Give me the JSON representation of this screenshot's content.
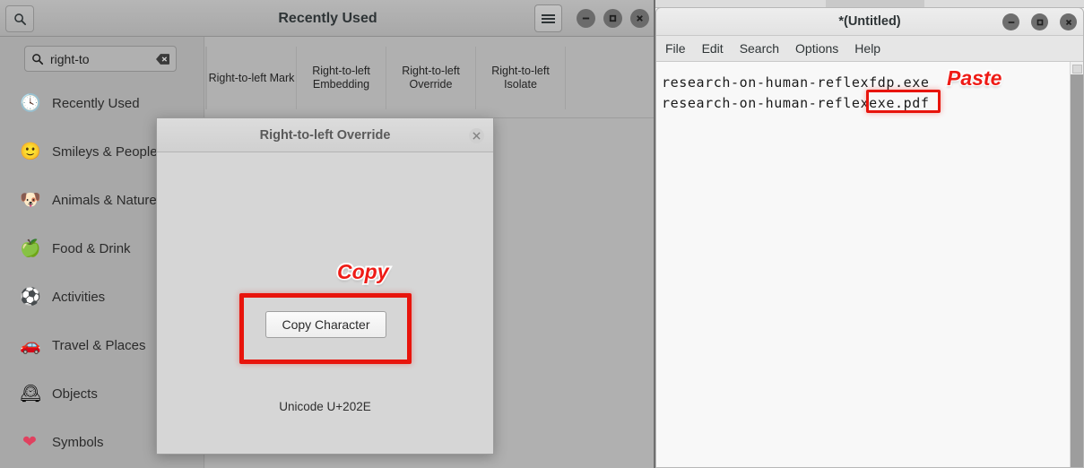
{
  "char_picker": {
    "title": "Recently Used",
    "search": {
      "value": "right-to",
      "icon": "search-icon",
      "clear_icon": "clear-icon"
    },
    "search_toggle_icon": "search-icon",
    "menu_icon": "hamburger-menu-icon",
    "window_buttons": {
      "minimize": "minimize-icon",
      "maximize": "maximize-icon",
      "close": "close-icon"
    },
    "sidebar": [
      {
        "label": "Recently Used",
        "emoji": "🕓",
        "icon": "clock-icon"
      },
      {
        "label": "Smileys & People",
        "emoji": "🙂",
        "icon": "smiley-icon"
      },
      {
        "label": "Animals & Nature",
        "emoji": "🐶",
        "icon": "dog-icon"
      },
      {
        "label": "Food & Drink",
        "emoji": "🍏",
        "icon": "apple-icon"
      },
      {
        "label": "Activities",
        "emoji": "⚽",
        "icon": "soccer-ball-icon"
      },
      {
        "label": "Travel & Places",
        "emoji": "🚗",
        "icon": "car-icon"
      },
      {
        "label": "Objects",
        "emoji": "🕰",
        "icon": "clock-object-icon"
      },
      {
        "label": "Symbols",
        "emoji": "❤",
        "icon": "heart-icon"
      }
    ],
    "characters": [
      {
        "label": "Right-to-left Mark"
      },
      {
        "label": "Right-to-left Embedding"
      },
      {
        "label": "Right-to-left Override"
      },
      {
        "label": "Right-to-left Isolate"
      }
    ]
  },
  "dialog": {
    "title": "Right-to-left Override",
    "close_icon": "close-icon",
    "copy_button": "Copy Character",
    "unicode": "Unicode U+202E"
  },
  "editor": {
    "title": "*(Untitled)",
    "menus": [
      "File",
      "Edit",
      "Search",
      "Options",
      "Help"
    ],
    "window_buttons": {
      "minimize": "minimize-icon",
      "maximize": "maximize-icon",
      "close": "close-icon"
    },
    "content": "research-on-human-reflexfdp.exe\nresearch-on-human-reflexexe.pdf",
    "scroll_arrow_icon": "scroll-up-arrow-icon"
  },
  "annotations": {
    "copy": "Copy",
    "paste": "Paste",
    "color": "#ee1b16"
  }
}
